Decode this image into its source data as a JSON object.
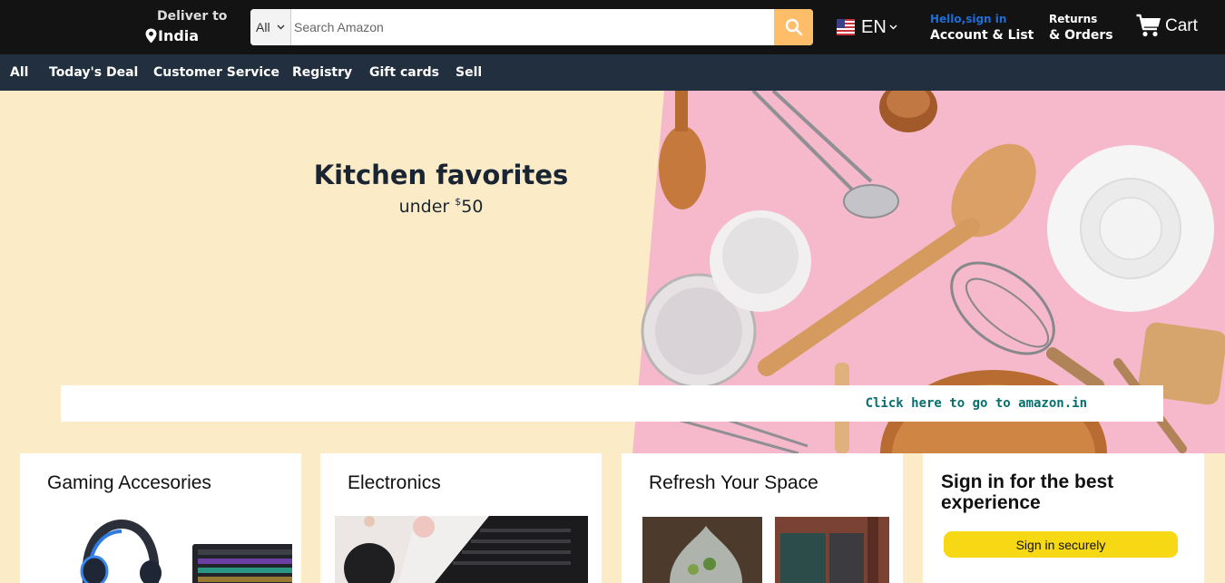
{
  "header": {
    "deliver_label": "Deliver to",
    "deliver_location": "India",
    "search": {
      "category": "All",
      "placeholder": "Search Amazon"
    },
    "language": "EN",
    "account_greeting": "Hello,sign in",
    "account_label": "Account & List",
    "returns_line1": "Returns",
    "returns_line2": "& Orders",
    "cart_label": "Cart"
  },
  "nav": {
    "items": [
      {
        "label": "All"
      },
      {
        "label": "Today's Deal"
      },
      {
        "label": "Customer Service"
      },
      {
        "label": "Registry"
      },
      {
        "label": "Gift cards"
      },
      {
        "label": "Sell"
      }
    ]
  },
  "hero": {
    "title": "Kitchen favorites",
    "subtitle_prefix": "under ",
    "subtitle_currency": "$",
    "subtitle_amount": "50",
    "link_text": "Click here to go to amazon.in"
  },
  "cards": [
    {
      "title": "Gaming Accesories"
    },
    {
      "title": "Electronics"
    },
    {
      "title": "Refresh Your Space"
    }
  ],
  "signin_card": {
    "title": "Sign in for the best experience",
    "button_label": "Sign in securely"
  },
  "colors": {
    "header_bg": "#131313",
    "nav_bg": "#222f3e",
    "page_bg": "#fbebc6",
    "search_button": "#febd69",
    "signin_button": "#f7d814",
    "link": "#076f70",
    "hello_text": "#1d6fd8"
  },
  "icons": {
    "location": "location-pin-icon",
    "search": "search-icon",
    "flag": "us-flag-icon",
    "cart": "cart-icon"
  }
}
